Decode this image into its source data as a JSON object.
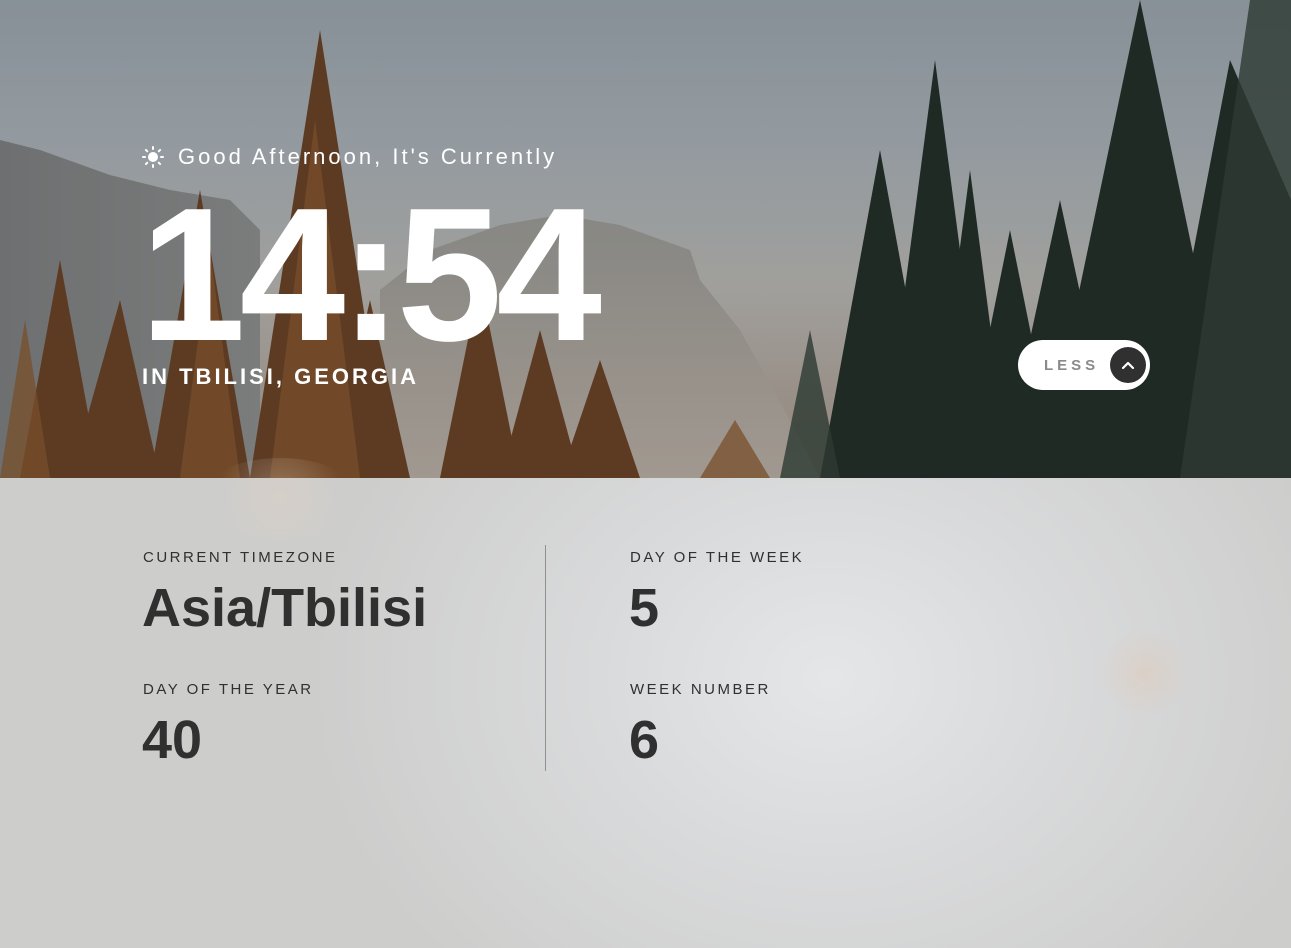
{
  "greeting": {
    "icon": "sun-icon",
    "text": "Good Afternoon, It's Currently"
  },
  "clock": {
    "time": "14:54"
  },
  "location": {
    "text": "IN TBILISI, GEORGIA"
  },
  "toggle": {
    "label": "LESS",
    "icon": "chevron-up-icon"
  },
  "details": {
    "timezone": {
      "label": "CURRENT TIMEZONE",
      "value": "Asia/Tbilisi"
    },
    "day_of_year": {
      "label": "DAY OF THE YEAR",
      "value": "40"
    },
    "day_of_week": {
      "label": "DAY OF THE WEEK",
      "value": "5"
    },
    "week_number": {
      "label": "WEEK NUMBER",
      "value": "6"
    }
  },
  "colors": {
    "text_light": "#ffffff",
    "text_dark": "#303030",
    "button_bg": "#ffffff",
    "chevron_bg": "#303030",
    "panel_bg": "#d9dadb"
  }
}
